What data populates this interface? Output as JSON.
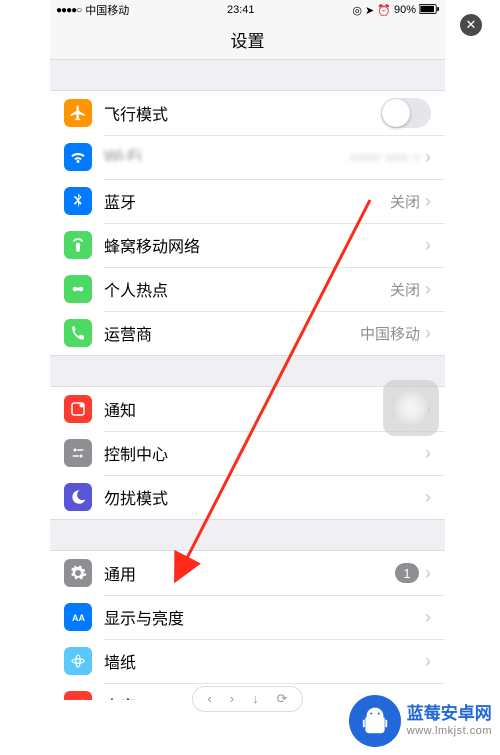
{
  "status": {
    "signal": "●●●●○",
    "carrier": "中国移动",
    "time": "23:41",
    "icons": "◎ ➤ ⏰",
    "battery_pct": "90%"
  },
  "nav": {
    "title": "设置"
  },
  "groups": [
    {
      "rows": [
        {
          "name": "airplane-mode",
          "icon": "airplane",
          "bg": "bg-orange",
          "label": "飞行模式",
          "kind": "switch",
          "on": false
        },
        {
          "name": "wifi",
          "icon": "wifi",
          "bg": "bg-blue",
          "label": "Wi-Fi",
          "kind": "link",
          "value": "••••• •••• •"
        },
        {
          "name": "bluetooth",
          "icon": "bluetooth",
          "bg": "bg-blue",
          "label": "蓝牙",
          "kind": "link",
          "value": "关闭"
        },
        {
          "name": "cellular",
          "icon": "cellular",
          "bg": "bg-green",
          "label": "蜂窝移动网络",
          "kind": "link"
        },
        {
          "name": "hotspot",
          "icon": "hotspot",
          "bg": "bg-green",
          "label": "个人热点",
          "kind": "link",
          "value": "关闭"
        },
        {
          "name": "carrier",
          "icon": "phone",
          "bg": "bg-greencall",
          "label": "运营商",
          "kind": "link",
          "value": "中国移动"
        }
      ]
    },
    {
      "rows": [
        {
          "name": "notifications",
          "icon": "notify",
          "bg": "bg-red",
          "label": "通知",
          "kind": "link"
        },
        {
          "name": "control-center",
          "icon": "control",
          "bg": "bg-grey",
          "label": "控制中心",
          "kind": "link"
        },
        {
          "name": "dnd",
          "icon": "moon",
          "bg": "bg-purple",
          "label": "勿扰模式",
          "kind": "link"
        }
      ]
    },
    {
      "rows": [
        {
          "name": "general",
          "icon": "gear",
          "bg": "bg-greyg",
          "label": "通用",
          "kind": "link",
          "badge": "1"
        },
        {
          "name": "display",
          "icon": "display",
          "bg": "bg-bluea",
          "label": "显示与亮度",
          "kind": "link"
        },
        {
          "name": "wallpaper",
          "icon": "flower",
          "bg": "bg-cyan",
          "label": "墙纸",
          "kind": "link"
        },
        {
          "name": "sounds",
          "icon": "speaker",
          "bg": "bg-red",
          "label": "声音",
          "kind": "link"
        }
      ]
    }
  ],
  "watermark": {
    "title": "蓝莓安卓网",
    "url": "www.lmkjst.com"
  },
  "toolbar_icons": [
    "‹",
    "›",
    "↓",
    "⟳"
  ],
  "annotation": {
    "arrow_from": "top-right",
    "arrow_to": "general-row",
    "color": "#ff2a1a"
  }
}
